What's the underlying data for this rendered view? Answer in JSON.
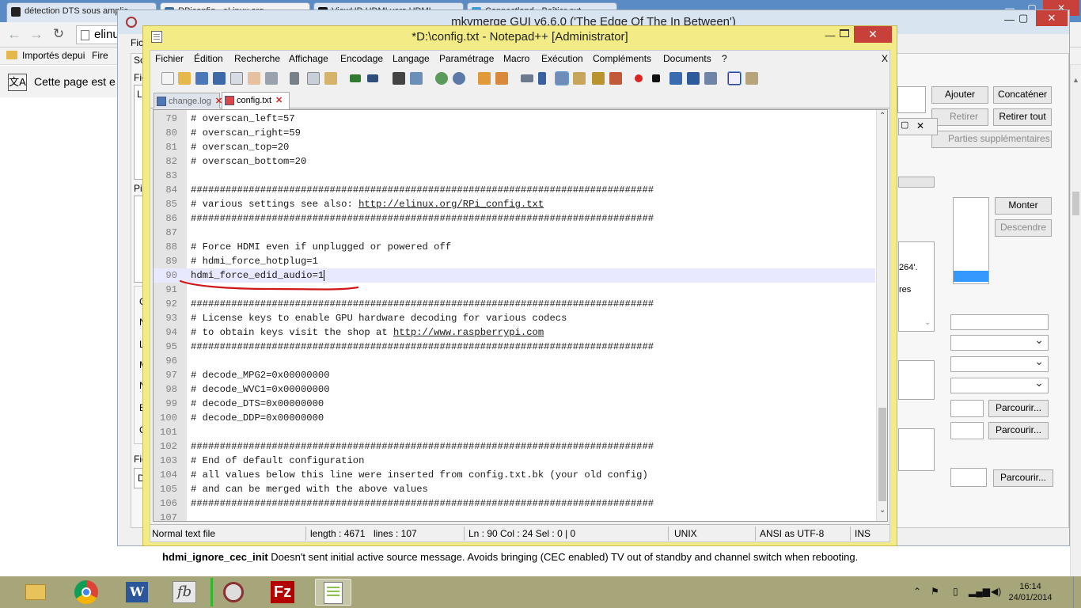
{
  "browser": {
    "tabs": [
      {
        "label": "détection DTS sous amplia"
      },
      {
        "label": "RPiconfig - eLinux.org"
      },
      {
        "label": "ViewHD HDMI vers HDMI"
      },
      {
        "label": "Connectland - Boîtier ext"
      }
    ],
    "omnibox_text": "elinu",
    "bookmarks": {
      "imported": "Importés depui",
      "firefox": "Fire"
    },
    "translate_text": "Cette page est e",
    "page_snippet_term": "hdmi_ignore_cec_init",
    "page_snippet_text": " Doesn't sent initial active source message. Avoids bringing (CEC enabled) TV out of standby and channel switch when rebooting."
  },
  "mkvmerge": {
    "title": "mkvmerge GUI v6.6.0 ('The Edge Of The In Between')",
    "left_labels": [
      "Fic",
      "So",
      "Fic",
      "Le",
      "Pis",
      "G",
      "N",
      "L",
      "M",
      "N",
      "E",
      "C",
      "Fic",
      "D"
    ],
    "buttons": {
      "add": "Ajouter",
      "append": "Concaténer",
      "remove": "Retirer",
      "remove_all": "Retirer tout",
      "additional_parts": "Parties supplémentaires",
      "up": "Monter",
      "down": "Descendre",
      "browse1": "Parcourir...",
      "browse2": "Parcourir...",
      "browse3": "Parcourir..."
    },
    "fragments": {
      "codec": "264'.",
      "res": "res"
    }
  },
  "npp": {
    "title": "*D:\\config.txt - Notepad++ [Administrator]",
    "menu": [
      "Fichier",
      "Édition",
      "Recherche",
      "Affichage",
      "Encodage",
      "Langage",
      "Paramétrage",
      "Macro",
      "Exécution",
      "Compléments",
      "Documents",
      "?"
    ],
    "menu_close": "X",
    "file_tabs": [
      {
        "label": "change.log",
        "active": false
      },
      {
        "label": "config.txt",
        "active": true
      }
    ],
    "lines": [
      {
        "n": "79",
        "t": "# overscan_left=57"
      },
      {
        "n": "80",
        "t": "# overscan_right=59"
      },
      {
        "n": "81",
        "t": "# overscan_top=20"
      },
      {
        "n": "82",
        "t": "# overscan_bottom=20"
      },
      {
        "n": "83",
        "t": ""
      },
      {
        "n": "84",
        "t": "################################################################################"
      },
      {
        "n": "85",
        "t": "# various settings see also: ",
        "link": "http://elinux.org/RPi_config.txt"
      },
      {
        "n": "86",
        "t": "################################################################################"
      },
      {
        "n": "87",
        "t": ""
      },
      {
        "n": "88",
        "t": "# Force HDMI even if unplugged or powered off"
      },
      {
        "n": "89",
        "t": "# hdmi_force_hotplug=1"
      },
      {
        "n": "90",
        "t": "hdmi_force_edid_audio=1"
      },
      {
        "n": "91",
        "t": ""
      },
      {
        "n": "92",
        "t": "################################################################################"
      },
      {
        "n": "93",
        "t": "# License keys to enable GPU hardware decoding for various codecs"
      },
      {
        "n": "94",
        "t": "# to obtain keys visit the shop at ",
        "link": "http://www.raspberrypi.com"
      },
      {
        "n": "95",
        "t": "################################################################################"
      },
      {
        "n": "96",
        "t": ""
      },
      {
        "n": "97",
        "t": "# decode_MPG2=0x00000000"
      },
      {
        "n": "98",
        "t": "# decode_WVC1=0x00000000"
      },
      {
        "n": "99",
        "t": "# decode_DTS=0x00000000"
      },
      {
        "n": "100",
        "t": "# decode_DDP=0x00000000"
      },
      {
        "n": "101",
        "t": ""
      },
      {
        "n": "102",
        "t": "################################################################################"
      },
      {
        "n": "103",
        "t": "# End of default configuration"
      },
      {
        "n": "104",
        "t": "# all values below this line were inserted from config.txt.bk (your old config)"
      },
      {
        "n": "105",
        "t": "# and can be merged with the above values"
      },
      {
        "n": "106",
        "t": "################################################################################"
      },
      {
        "n": "107",
        "t": ""
      }
    ],
    "status": {
      "type": "Normal text file",
      "length": "length : 4671",
      "lines": "lines : 107",
      "pos": "Ln : 90    Col : 24    Sel : 0 | 0",
      "eol": "UNIX",
      "encoding": "ANSI as UTF-8",
      "mode": "INS"
    }
  },
  "taskbar": {
    "clock_time": "16:14",
    "clock_date": "24/01/2014"
  }
}
